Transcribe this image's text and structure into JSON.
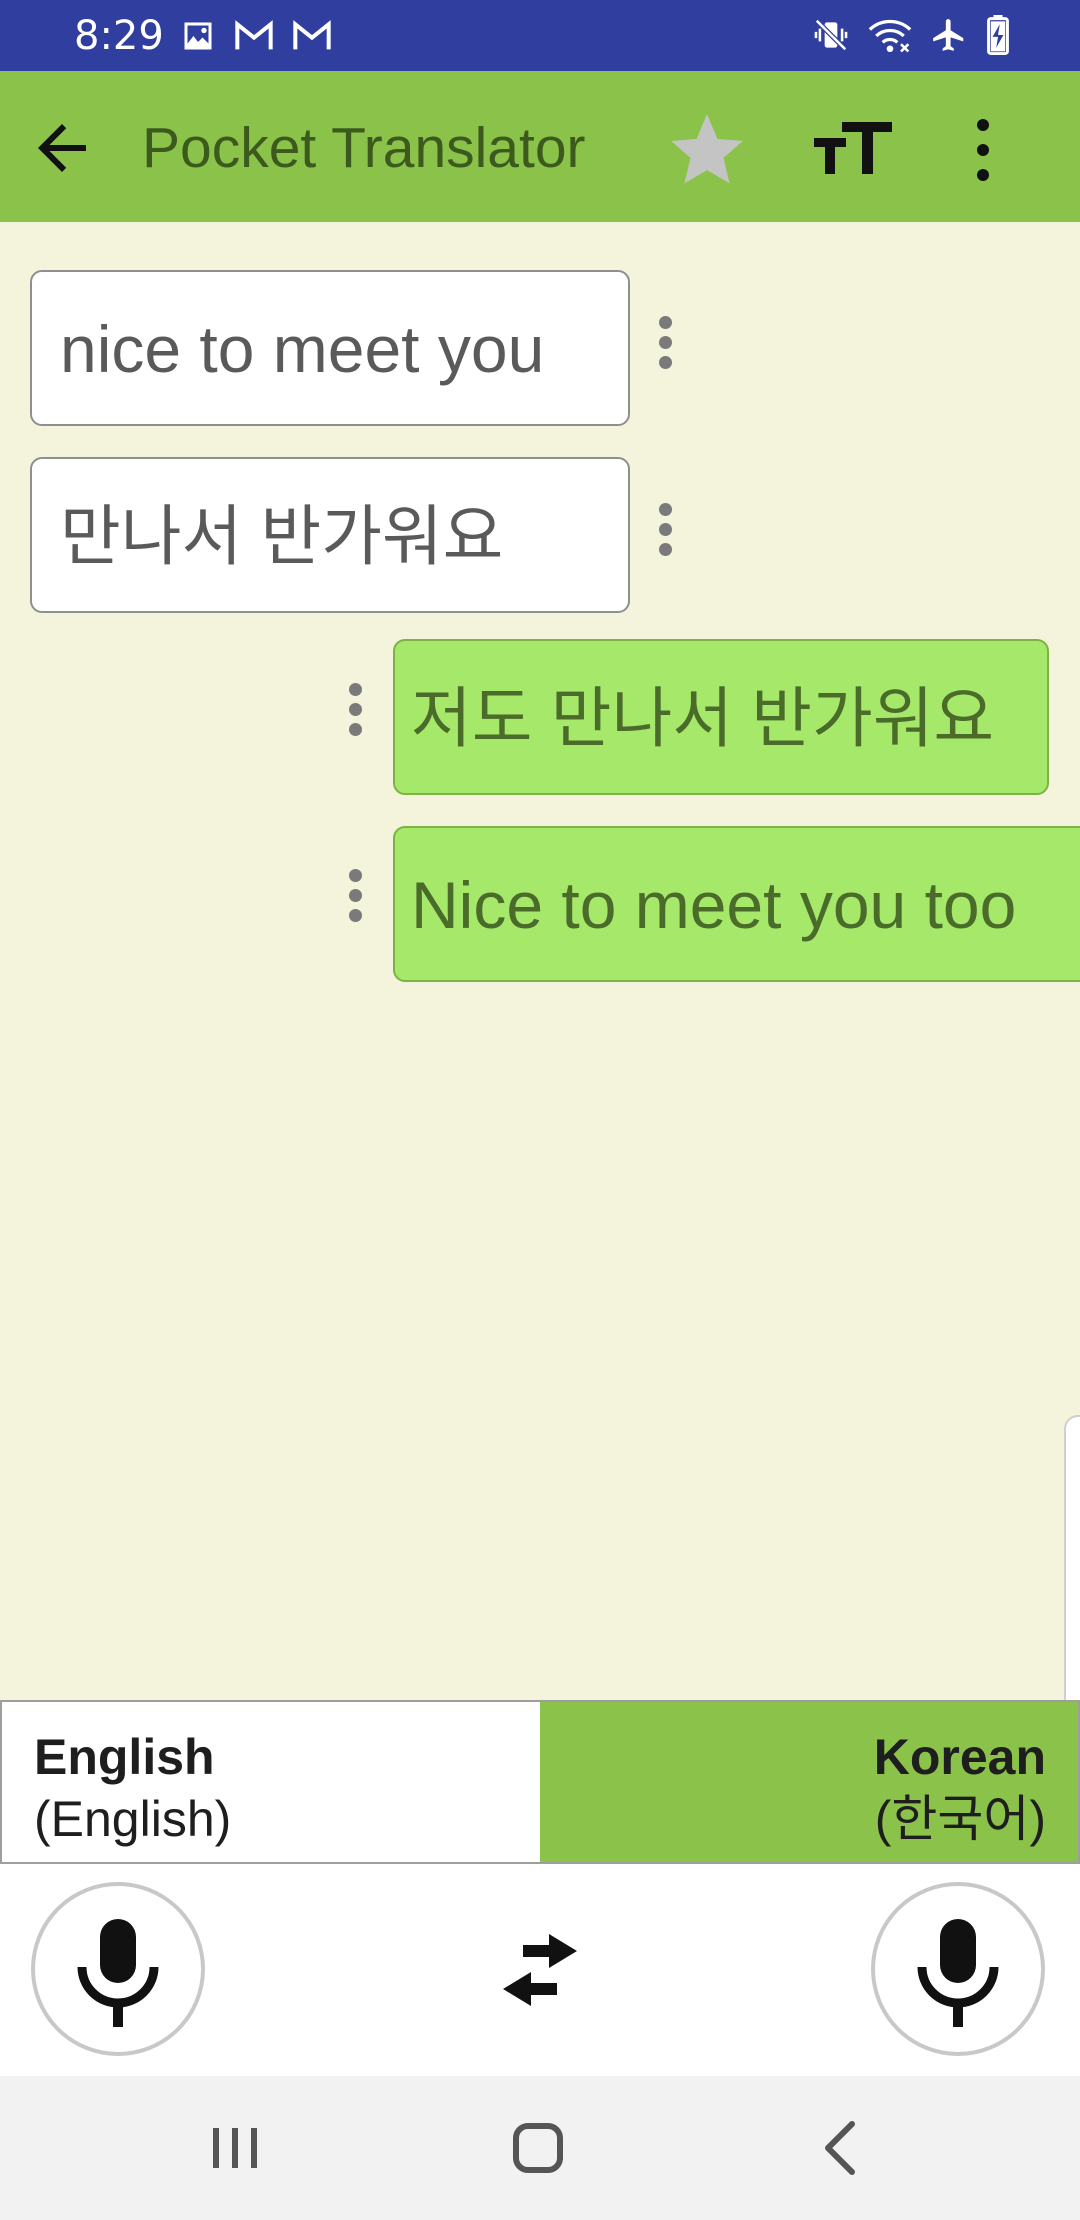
{
  "status_bar": {
    "time": "8:29",
    "left_icons": [
      "image-icon",
      "gmail-icon",
      "gmail-icon"
    ],
    "right_icons": [
      "vibrate-mute-icon",
      "wifi-icon",
      "airplane-mode-icon",
      "battery-charging-icon"
    ]
  },
  "app_bar": {
    "title": "Pocket Translator",
    "icons": [
      "arrow-back-icon",
      "star-icon",
      "text-size-icon",
      "more-vert-icon"
    ]
  },
  "messages": [
    {
      "side": "left",
      "text": "nice to meet you"
    },
    {
      "side": "left",
      "text": "만나서 반가워요"
    },
    {
      "side": "right",
      "text": "저도 만나서 반가워요"
    },
    {
      "side": "right",
      "text": "Nice to meet you too"
    }
  ],
  "languages": {
    "left": {
      "name": "English",
      "native": "(English)"
    },
    "right": {
      "name": "Korean",
      "native": "(한국어)"
    }
  },
  "controls": {
    "icons": [
      "mic-icon",
      "swap-icon",
      "mic-icon"
    ]
  },
  "nav_bar": {
    "icons": [
      "recents-icon",
      "home-icon",
      "back-icon"
    ]
  },
  "colors": {
    "status_bar": "#303f9f",
    "app_bar": "#8bc34a",
    "chat_background": "#f4f4dc",
    "outgoing_bubble": "#a5e86a",
    "incoming_bubble": "#ffffff"
  }
}
